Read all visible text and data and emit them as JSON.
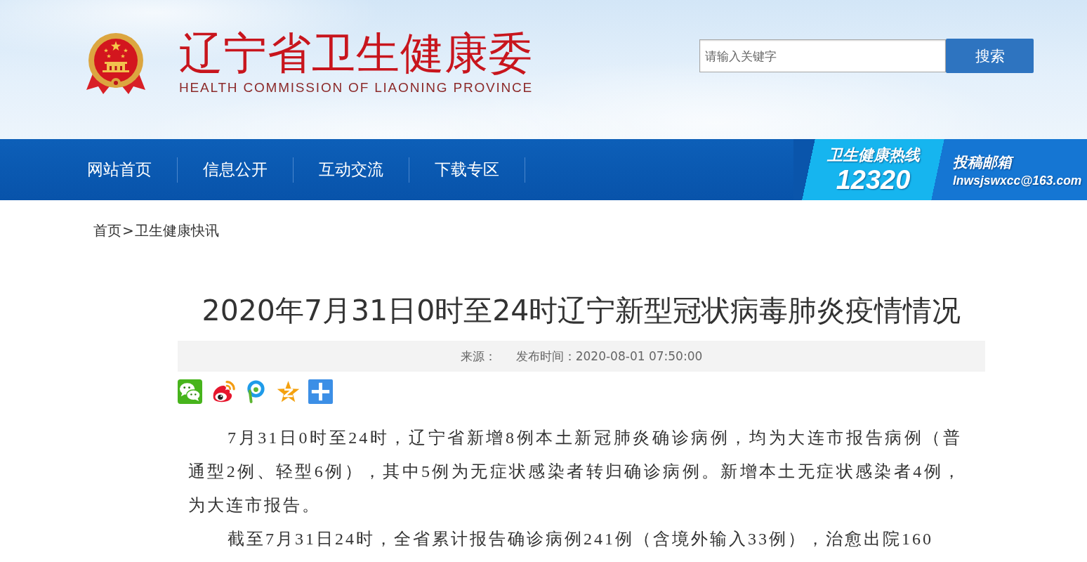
{
  "header": {
    "title": "辽宁省卫生健康委",
    "subtitle": "HEALTH COMMISSION OF LIAONING PROVINCE",
    "search": {
      "placeholder": "请输入关键字",
      "button": "搜索"
    }
  },
  "nav": {
    "items": [
      "网站首页",
      "信息公开",
      "互动交流",
      "下载专区"
    ],
    "hotline": {
      "label": "卫生健康热线",
      "number": "12320"
    },
    "mailbox": {
      "label": "投稿邮箱",
      "address": "lnwsjswxcc@163.com"
    }
  },
  "breadcrumb": {
    "items": [
      "首页",
      "卫生健康快讯"
    ],
    "separator": ">"
  },
  "article": {
    "title": "2020年7月31日0时至24时辽宁新型冠状病毒肺炎疫情情况",
    "meta": {
      "source_label": "来源：",
      "published": "发布时间：2020-08-01 07:50:00"
    },
    "paragraphs": [
      "7月31日0时至24时，辽宁省新增8例本土新冠肺炎确诊病例，均为大连市报告病例（普通型2例、轻型6例），其中5例为无症状感染者转归确诊病例。新增本土无症状感染者4例，为大连市报告。",
      "截至7月31日24时，全省累计报告确诊病例241例（含境外输入33例），治愈出院160"
    ]
  }
}
